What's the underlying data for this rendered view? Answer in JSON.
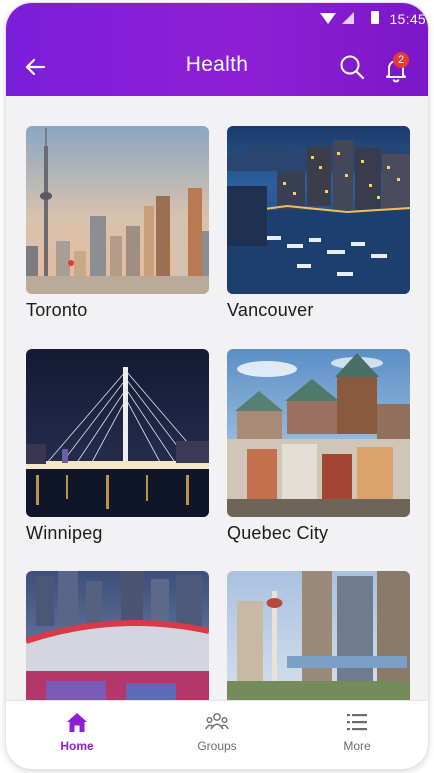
{
  "status_bar": {
    "time": "15:45"
  },
  "header": {
    "title": "Health",
    "notification_count": "2"
  },
  "cities": [
    {
      "name": "Toronto"
    },
    {
      "name": "Vancouver"
    },
    {
      "name": "Winnipeg"
    },
    {
      "name": "Quebec City"
    },
    {
      "name": ""
    },
    {
      "name": ""
    }
  ],
  "tabs": [
    {
      "label": "Home",
      "icon": "home-icon",
      "active": true
    },
    {
      "label": "Groups",
      "icon": "groups-icon",
      "active": false
    },
    {
      "label": "More",
      "icon": "menu-icon",
      "active": false
    }
  ],
  "colors": {
    "accent": "#8e1fd3",
    "badge": "#e53935",
    "background": "#f2f1f4"
  }
}
